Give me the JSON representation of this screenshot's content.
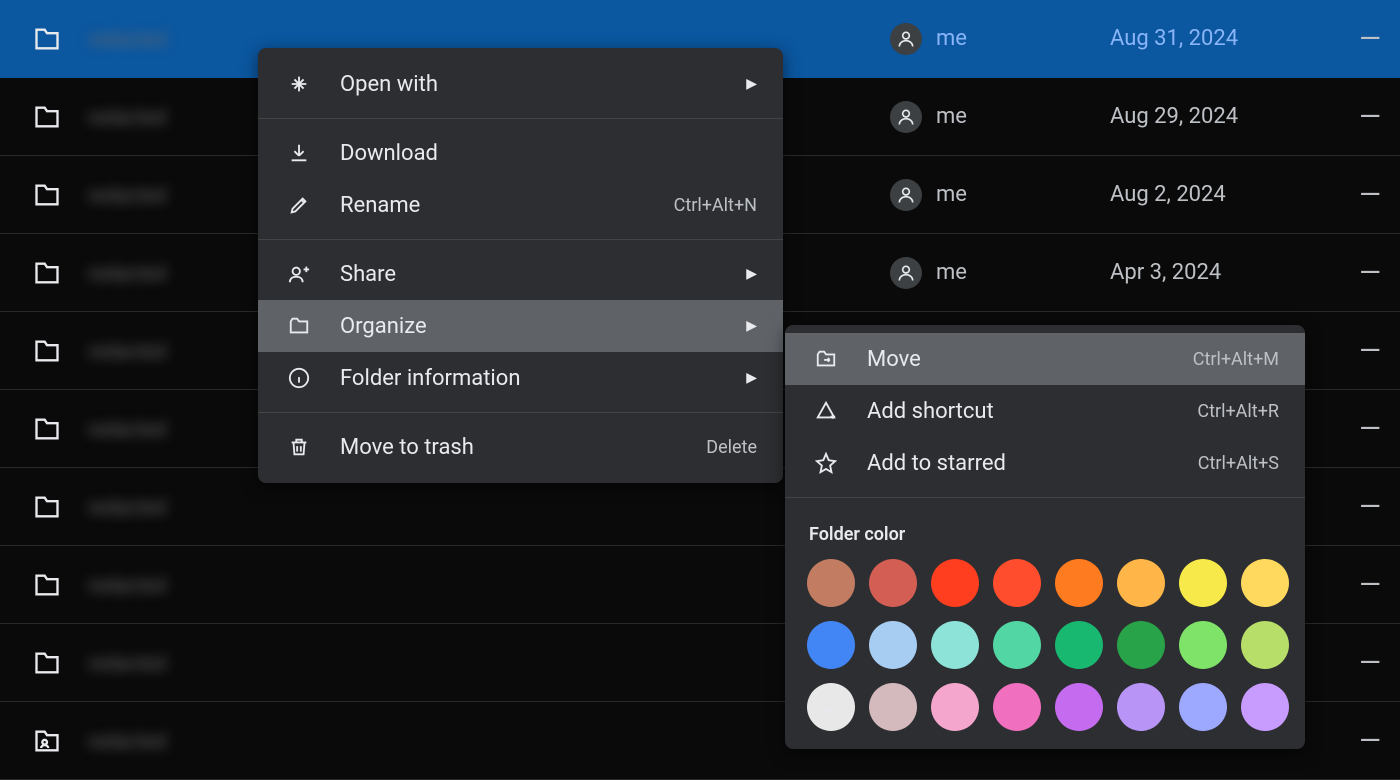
{
  "rows": [
    {
      "owner": "me",
      "date": "Aug 31, 2024",
      "selected": true,
      "shared": false
    },
    {
      "owner": "me",
      "date": "Aug 29, 2024",
      "selected": false,
      "shared": false
    },
    {
      "owner": "me",
      "date": "Aug 2, 2024",
      "selected": false,
      "shared": false
    },
    {
      "owner": "me",
      "date": "Apr 3, 2024",
      "selected": false,
      "shared": false
    },
    {
      "owner": "",
      "date": "",
      "selected": false,
      "shared": false
    },
    {
      "owner": "",
      "date": "",
      "selected": false,
      "shared": false
    },
    {
      "owner": "",
      "date": "",
      "selected": false,
      "shared": false
    },
    {
      "owner": "",
      "date": "",
      "selected": false,
      "shared": false
    },
    {
      "owner": "",
      "date": "",
      "selected": false,
      "shared": false
    },
    {
      "owner": "",
      "date": "",
      "selected": false,
      "shared": true
    }
  ],
  "menu": {
    "open_with": "Open with",
    "download": "Download",
    "rename": "Rename",
    "rename_shortcut": "Ctrl+Alt+N",
    "share": "Share",
    "organize": "Organize",
    "folder_info": "Folder information",
    "trash": "Move to trash",
    "trash_shortcut": "Delete"
  },
  "submenu": {
    "move": "Move",
    "move_shortcut": "Ctrl+Alt+M",
    "add_shortcut": "Add shortcut",
    "add_shortcut_shortcut": "Ctrl+Alt+R",
    "add_starred": "Add to starred",
    "add_starred_shortcut": "Ctrl+Alt+S",
    "folder_color": "Folder color"
  },
  "colors": [
    {
      "hex": "#c17c62",
      "selected": false
    },
    {
      "hex": "#d35f54",
      "selected": false
    },
    {
      "hex": "#ff3d1f",
      "selected": false
    },
    {
      "hex": "#ff4d2e",
      "selected": false
    },
    {
      "hex": "#ff7b1f",
      "selected": false
    },
    {
      "hex": "#ffb547",
      "selected": false
    },
    {
      "hex": "#f7e94a",
      "selected": false
    },
    {
      "hex": "#ffd95e",
      "selected": false
    },
    {
      "hex": "#4285f4",
      "selected": false
    },
    {
      "hex": "#a7cdf2",
      "selected": false
    },
    {
      "hex": "#8de3d8",
      "selected": false
    },
    {
      "hex": "#52d6a3",
      "selected": false
    },
    {
      "hex": "#19b871",
      "selected": false
    },
    {
      "hex": "#29a349",
      "selected": false
    },
    {
      "hex": "#7fe36a",
      "selected": false
    },
    {
      "hex": "#b8de6a",
      "selected": false
    },
    {
      "hex": "#e8e8e8",
      "selected": true
    },
    {
      "hex": "#d4b9bd",
      "selected": false
    },
    {
      "hex": "#f4a6cc",
      "selected": false
    },
    {
      "hex": "#f06fbf",
      "selected": false
    },
    {
      "hex": "#c56bf0",
      "selected": false
    },
    {
      "hex": "#b794f6",
      "selected": false
    },
    {
      "hex": "#9da8ff",
      "selected": false
    },
    {
      "hex": "#c89bff",
      "selected": false
    }
  ],
  "dash": "—"
}
